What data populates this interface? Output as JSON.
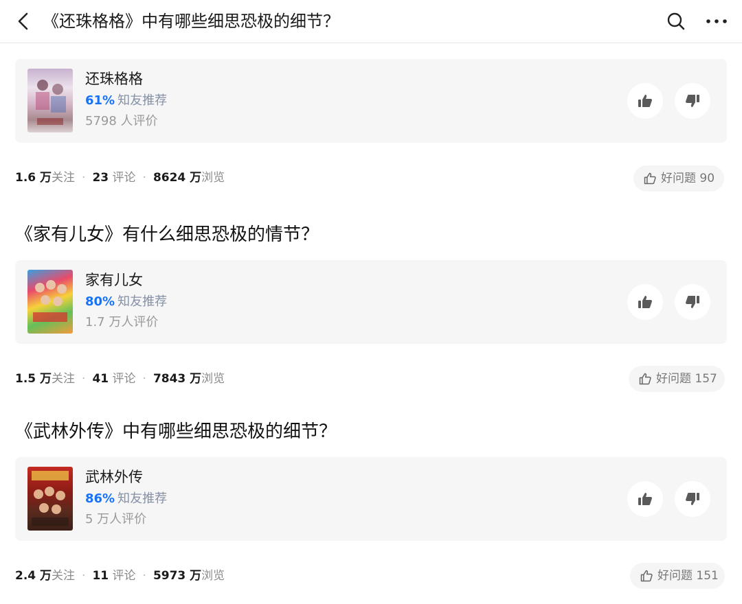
{
  "header": {
    "title": "《还珠格格》中有哪些细思恐极的细节？",
    "back_icon": "chevron-left-icon",
    "search_icon": "search-icon",
    "more_icon": "more-horizontal-icon"
  },
  "items": [
    {
      "title": "",
      "card": {
        "name": "还珠格格",
        "percent": "61%",
        "recommend_label": "知友推荐",
        "ratings": "5798 人评价"
      },
      "stats": {
        "follow_num": "1.6 万",
        "follow_label": "关注",
        "comment_num": "23",
        "comment_label": "评论",
        "view_num": "8624 万",
        "view_label": "浏览",
        "sep": "·"
      },
      "good": "好问题 90"
    },
    {
      "title": "《家有儿女》有什么细思恐极的情节？",
      "card": {
        "name": "家有儿女",
        "percent": "80%",
        "recommend_label": "知友推荐",
        "ratings": "1.7 万人评价"
      },
      "stats": {
        "follow_num": "1.5 万",
        "follow_label": "关注",
        "comment_num": "41",
        "comment_label": "评论",
        "view_num": "7843 万",
        "view_label": "浏览",
        "sep": "·"
      },
      "good": "好问题 157"
    },
    {
      "title": "《武林外传》中有哪些细思恐极的细节？",
      "card": {
        "name": "武林外传",
        "percent": "86%",
        "recommend_label": "知友推荐",
        "ratings": "5 万人评价"
      },
      "stats": {
        "follow_num": "2.4 万",
        "follow_label": "关注",
        "comment_num": "11",
        "comment_label": "评论",
        "view_num": "5973 万",
        "view_label": "浏览",
        "sep": "·"
      },
      "good": "好问题 151"
    }
  ],
  "icons": {
    "like": "thumbs-up-icon",
    "dislike": "thumbs-down-icon",
    "good_question": "thumbs-up-outline-icon"
  },
  "colors": {
    "accent": "#1772f6",
    "card_bg": "#f6f6f6",
    "muted": "#8a8a8a"
  }
}
